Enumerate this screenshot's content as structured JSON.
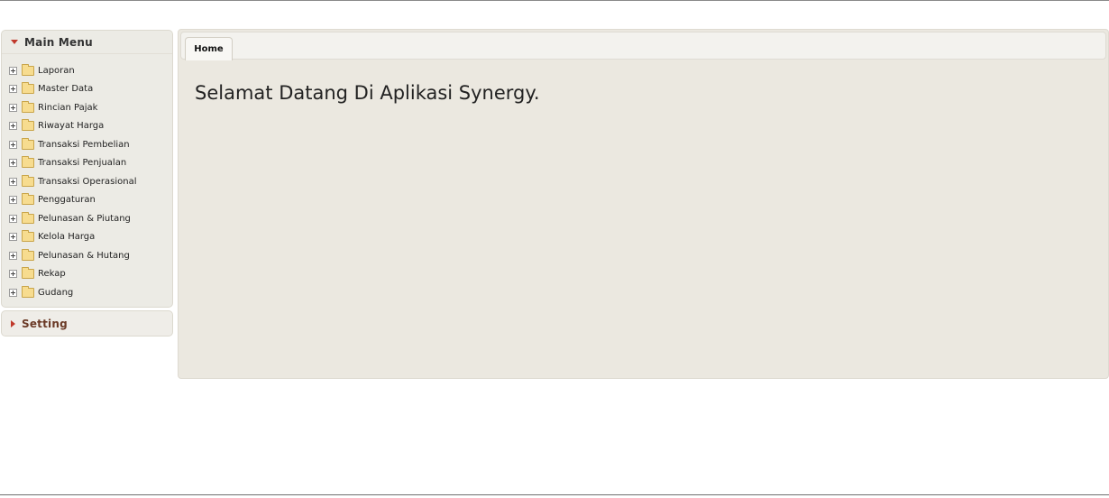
{
  "sidebar": {
    "main_menu": {
      "title": "Main Menu",
      "items": [
        {
          "label": "Laporan"
        },
        {
          "label": "Master Data"
        },
        {
          "label": "Rincian Pajak"
        },
        {
          "label": "Riwayat Harga"
        },
        {
          "label": "Transaksi Pembelian"
        },
        {
          "label": "Transaksi Penjualan"
        },
        {
          "label": "Transaksi Operasional"
        },
        {
          "label": "Penggaturan"
        },
        {
          "label": "Pelunasan & Piutang"
        },
        {
          "label": "Kelola Harga"
        },
        {
          "label": "Pelunasan & Hutang"
        },
        {
          "label": "Rekap"
        },
        {
          "label": "Gudang"
        }
      ]
    },
    "setting": {
      "title": "Setting"
    }
  },
  "tabs": [
    {
      "label": "Home",
      "active": true
    }
  ],
  "main": {
    "welcome_text": "Selamat Datang Di Aplikasi Synergy."
  },
  "colors": {
    "accent_arrow": "#c0392b",
    "panel_background": "#ecebe5",
    "content_background": "#ebe8e0"
  }
}
